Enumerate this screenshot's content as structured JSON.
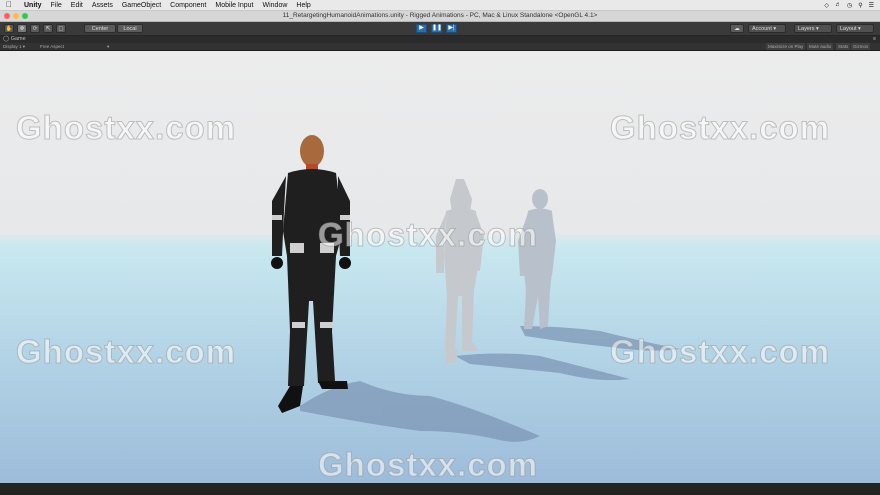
{
  "menubar": {
    "apple": "",
    "app_name": "Unity",
    "menus": [
      "File",
      "Edit",
      "Assets",
      "GameObject",
      "Component",
      "Mobile Input",
      "Window",
      "Help"
    ]
  },
  "window": {
    "title": "11_RetargetingHumanoidAnimations.unity - Rigged Animations - PC, Mac & Linux Standalone <OpenGL 4.1>"
  },
  "toolbar": {
    "pivot_label": "Center",
    "space_label": "Local",
    "account_label": "Account",
    "layers_label": "Layers",
    "layout_label": "Layout"
  },
  "game_view": {
    "tab_label": "Game",
    "display_label": "Display 1",
    "aspect_label": "Free Aspect",
    "buttons": [
      "Maximize on Play",
      "Mute audio",
      "Stats",
      "Gizmos"
    ]
  },
  "watermark": "Ghostxx.com",
  "colors": {
    "accent_play": "#2d6ea8",
    "sky": "#ececec",
    "ground": "#b3d4e6"
  }
}
